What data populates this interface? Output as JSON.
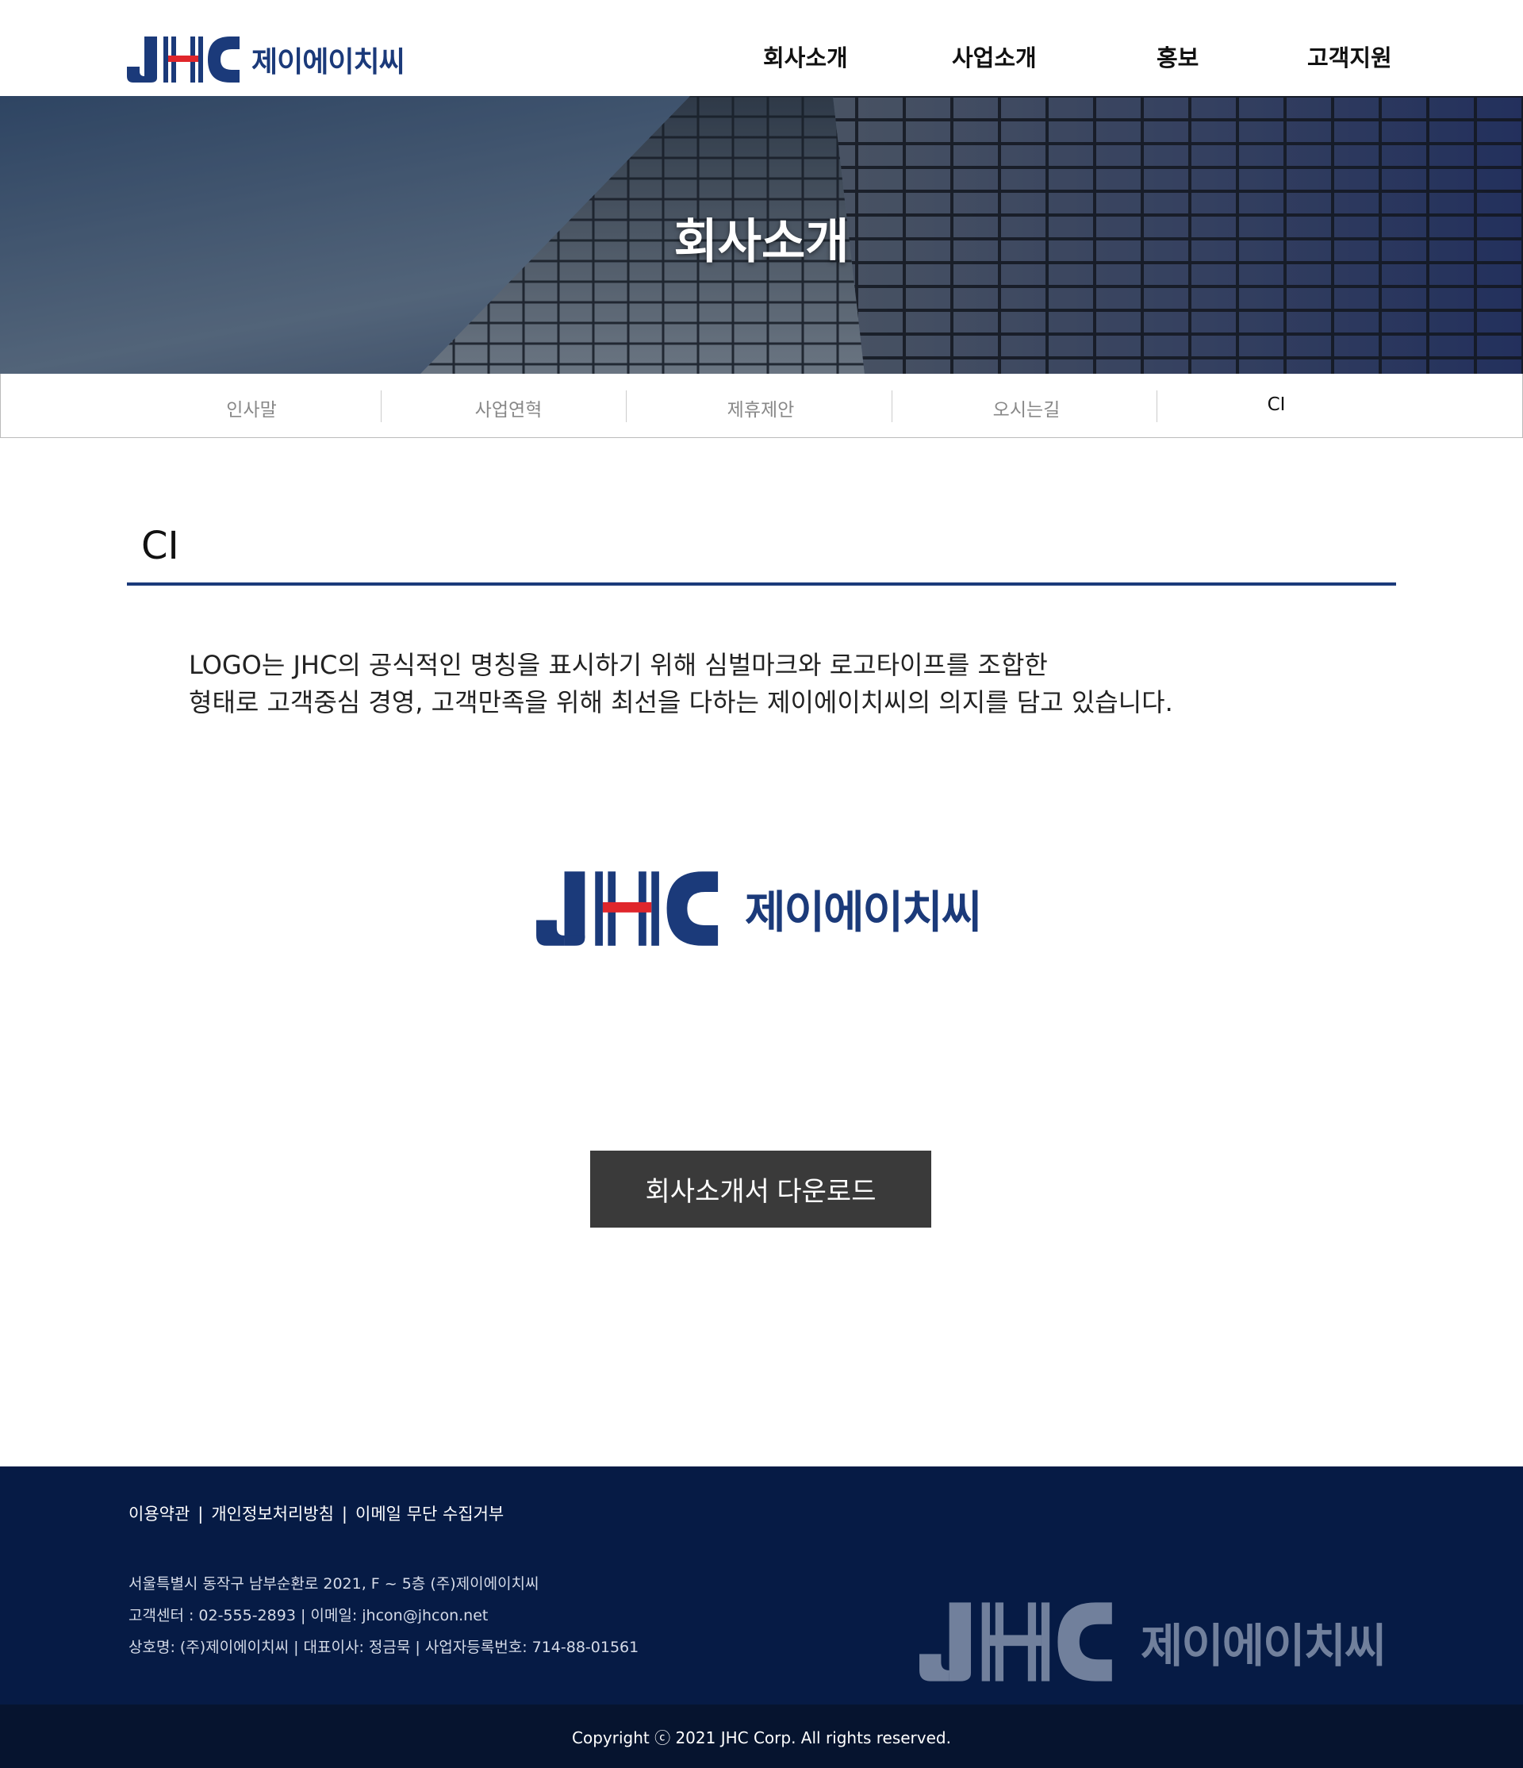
{
  "header": {
    "logo_text": "제이에이치씨",
    "nav": [
      "회사소개",
      "사업소개",
      "홍보",
      "고객지원"
    ]
  },
  "hero": {
    "title": "회사소개"
  },
  "subnav": {
    "tabs": [
      "인사말",
      "사업연혁",
      "제휴제안",
      "오시는길",
      "CI"
    ],
    "active": "CI"
  },
  "content": {
    "section_title": "CI",
    "description": [
      "LOGO는 JHC의 공식적인 명칭을 표시하기 위해 심벌마크와 로고타이프를 조합한",
      "형태로 고객중심 경영, 고객만족을 위해 최선을 다하는 제이에이치씨의 의지를 담고 있습니다."
    ],
    "logo_text": "제이에이치씨",
    "download_button": "회사소개서 다운로드"
  },
  "footer": {
    "links": [
      "이용약관",
      "개인정보처리방침",
      "이메일 무단 수집거부"
    ],
    "separator": "|",
    "info": [
      "서울특별시 동작구 남부순환로 2021, F ~ 5층 (주)제이에이치씨",
      "고객센터 : 02-555-2893  |  이메일: jhcon@jhcon.net",
      "상호명: (주)제이에이치씨  |  대표이사: 정금묵  |  사업자등록번호: 714-88-01561"
    ],
    "logo_text": "제이에이치씨",
    "copyright": "Copyright ⓒ 2021 JHC Corp. All rights reserved."
  },
  "colors": {
    "brand_navy": "#1b3a7a",
    "brand_red": "#e0262b",
    "footer_bg": "#061b45",
    "button_bg": "#3a3a3a"
  }
}
